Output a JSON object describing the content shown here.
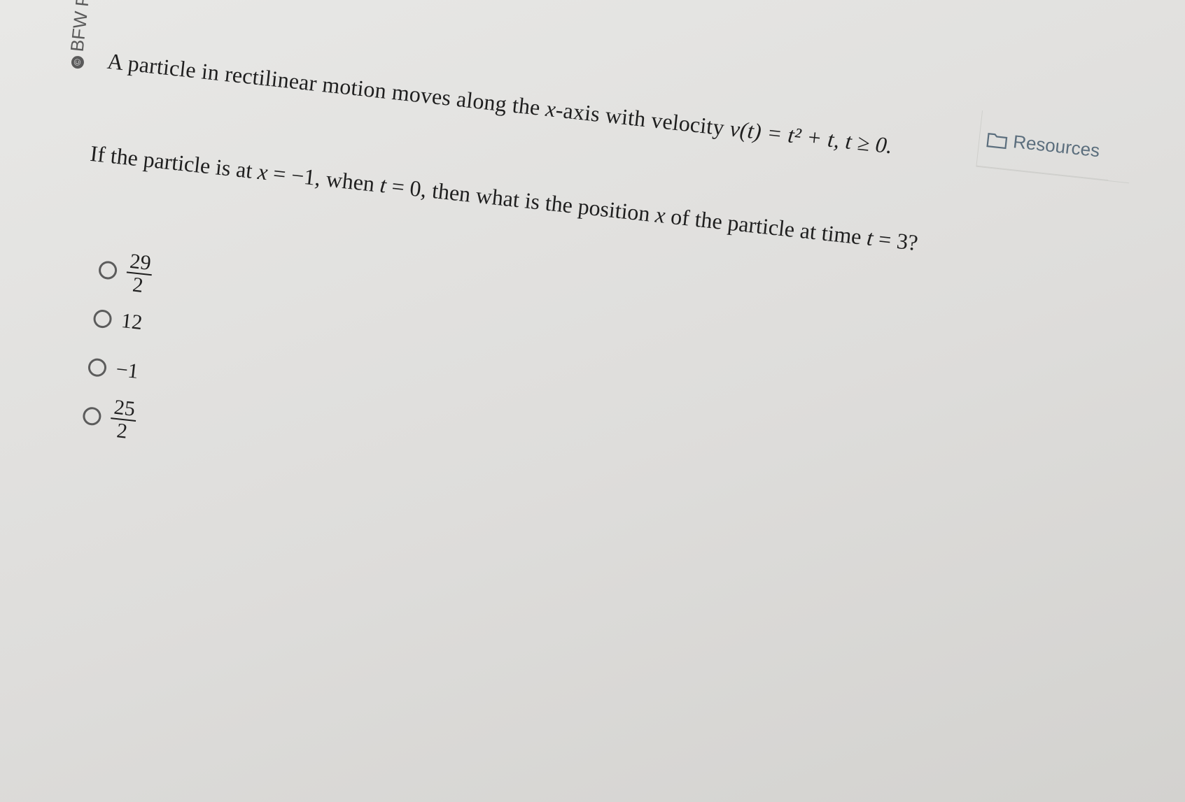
{
  "watermark": "BFW Publishers",
  "resources_label": "Resources",
  "question": {
    "line1_text": "A particle in rectilinear motion moves along the ",
    "line1_var": "x",
    "line1_text2": "-axis with velocity ",
    "line1_math": "v(t) = t² + t, t ≥ 0.",
    "line2_text": "If the particle is at ",
    "line2_math1": "x",
    "line2_eq1": " = −1, when ",
    "line2_math2": "t",
    "line2_eq2": " = 0, then what is the position ",
    "line2_math3": "x",
    "line2_text3": " of the particle at time ",
    "line2_math4": "t",
    "line2_eq3": " = 3?"
  },
  "options": [
    {
      "type": "fraction",
      "numerator": "29",
      "denominator": "2"
    },
    {
      "type": "value",
      "text": "12"
    },
    {
      "type": "value",
      "text": "−1"
    },
    {
      "type": "fraction",
      "numerator": "25",
      "denominator": "2"
    }
  ]
}
